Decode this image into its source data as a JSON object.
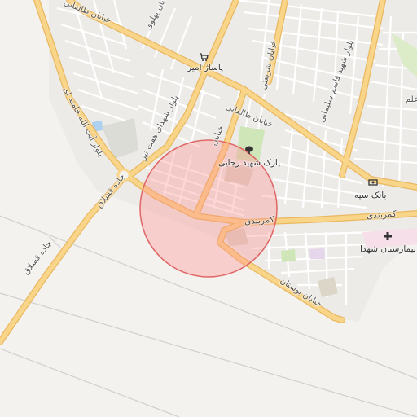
{
  "map": {
    "style": "street-map",
    "colors": {
      "background": "#f4f2ee",
      "urban": "#ecebe7",
      "minor_road": "#ffffff",
      "major_road": "#f9d58a",
      "major_road_outline": "#e9b861",
      "park": "#cfe6b8",
      "building": "#dcd6c8",
      "hospital_area": "#f6dfe8",
      "water": "#aed1f0",
      "highlight_circle_fill": "#ff8c8c",
      "highlight_circle_stroke": "#e06666"
    },
    "highlight": {
      "shape": "circle",
      "description": "highlighted area"
    }
  },
  "labels": {
    "kh_taleghani_top": "خیابان طالقانی",
    "kh_pahlavi": "خیابان پهلوی",
    "pasaj_amir": "پاساژ امیر",
    "kh_sharafi": "خیابان شریعتی",
    "shahid_soleimani": "بلوار شهید قاسم سلیمانی",
    "alam": "علم",
    "ayatollah_khamenei": "بلوار آیت الله خامنه ای",
    "haft_tir": "بلوار شهدای هفت تیر",
    "kh_taleghani": "خیابان طالقانی",
    "park_rajaei": "پارک شهید رجایی",
    "bank_sepah": "بانک سپه",
    "jadeh_top": "جاده قشلاق",
    "jadeh_bottom": "جاده قشلاق",
    "kamarbandi_center": "کمربندی",
    "kamarbandi_right": "کمربندی",
    "bimarestan": "بیمارستان شهدا",
    "kh_bustan": "خیابان بوستان",
    "kh_center": "خیابان"
  },
  "icons": {
    "shop": "shopping-cart-icon",
    "park": "tree-icon",
    "bank": "bank-icon",
    "hospital": "hospital-cross-icon"
  }
}
